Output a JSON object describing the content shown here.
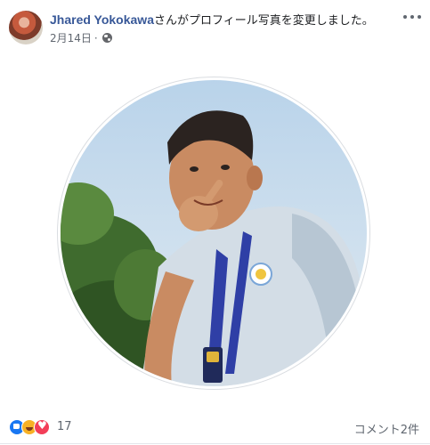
{
  "post": {
    "author_name": "Jhared Yokokawa",
    "action_text": "さんがプロフィール写真を変更しました。",
    "date": "2月14日",
    "separator": "·",
    "privacy_icon": "globe-icon",
    "menu_icon": "more-options-icon"
  },
  "photo": {
    "description_icon": "profile-photo"
  },
  "reactions": {
    "icons": [
      "like-icon",
      "haha-icon",
      "love-icon"
    ],
    "count": "17",
    "comments": "コメント2件"
  }
}
